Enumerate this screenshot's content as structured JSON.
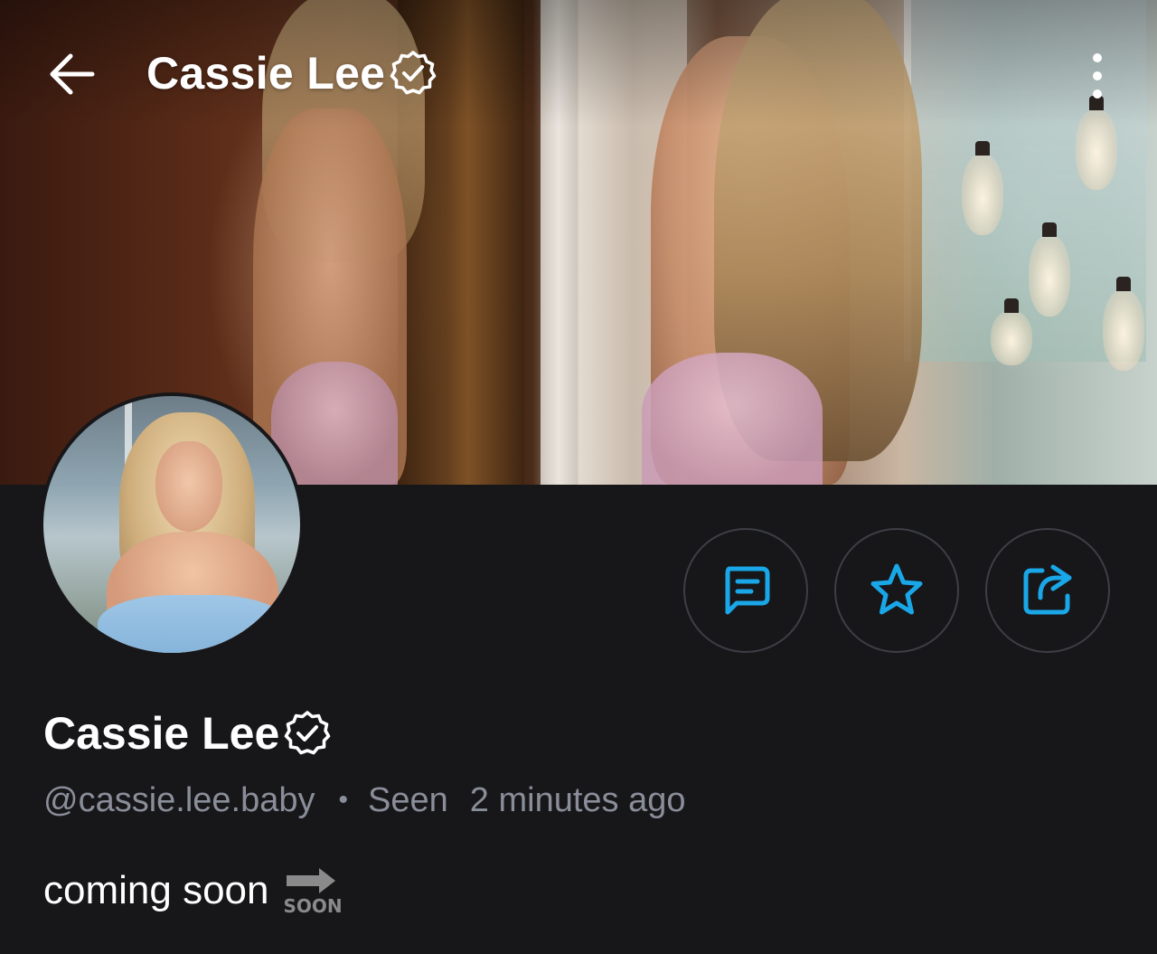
{
  "header": {
    "title": "Cassie Lee",
    "back_icon": "arrow-left-icon",
    "more_icon": "more-vertical-icon",
    "verified_icon": "verified-badge-icon"
  },
  "profile": {
    "name": "Cassie Lee",
    "handle": "@cassie.lee.baby",
    "separator": "•",
    "seen_label": "Seen",
    "last_seen": "2 minutes ago",
    "bio": "coming soon",
    "bio_emoji_text": "SOON"
  },
  "actions": {
    "message_icon": "message-square-icon",
    "favorite_icon": "star-icon",
    "share_icon": "share-icon"
  },
  "colors": {
    "background": "#17171a",
    "accent": "#1aa7e8",
    "text_primary": "#ffffff",
    "text_secondary": "#8a8e99",
    "button_border": "#3d3f45"
  }
}
